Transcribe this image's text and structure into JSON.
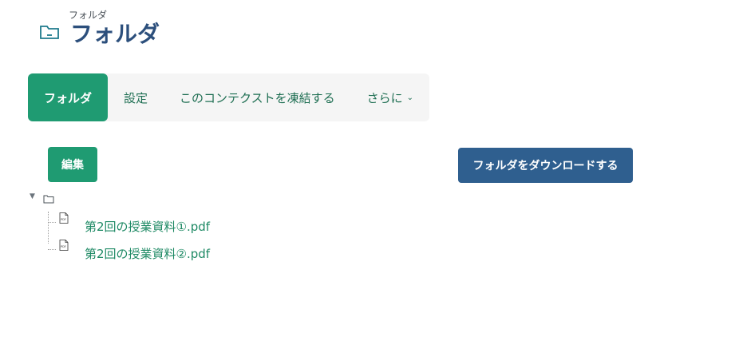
{
  "header": {
    "pre_title": "フォルダ",
    "title": "フォルダ",
    "icon": "folder-icon"
  },
  "nav": {
    "items": [
      {
        "label": "フォルダ",
        "active": true
      },
      {
        "label": "設定",
        "active": false
      },
      {
        "label": "このコンテクストを凍結する",
        "active": false
      },
      {
        "label": "さらに",
        "active": false
      }
    ]
  },
  "actions": {
    "edit_label": "編集",
    "download_label": "フォルダをダウンロードする"
  },
  "tree": {
    "files": [
      {
        "name": "第2回の授業資料①.pdf",
        "icon": "pdf-icon"
      },
      {
        "name": "第2回の授業資料②.pdf",
        "icon": "pdf-icon"
      }
    ]
  },
  "colors": {
    "primary_green": "#1f9b72",
    "primary_blue": "#2f5f8f",
    "title_blue": "#2c4f7c",
    "link_green": "#1f8a65"
  }
}
